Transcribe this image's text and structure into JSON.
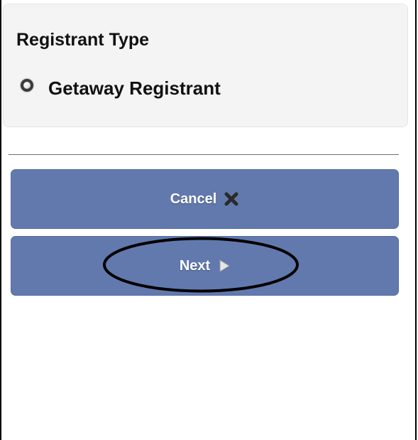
{
  "registrant_panel": {
    "title": "Registrant Type",
    "options": [
      {
        "label": "Getaway Registrant",
        "selected": true
      }
    ]
  },
  "buttons": {
    "cancel": {
      "label": "Cancel",
      "icon": "close-icon"
    },
    "next": {
      "label": "Next",
      "icon": "play-arrow-icon"
    }
  },
  "colors": {
    "button_bg": "#6279ae",
    "panel_bg": "#f4f4f4",
    "annotation_ellipse": "#000000"
  },
  "annotation": {
    "shape": "ellipse",
    "highlights": "next-button"
  }
}
